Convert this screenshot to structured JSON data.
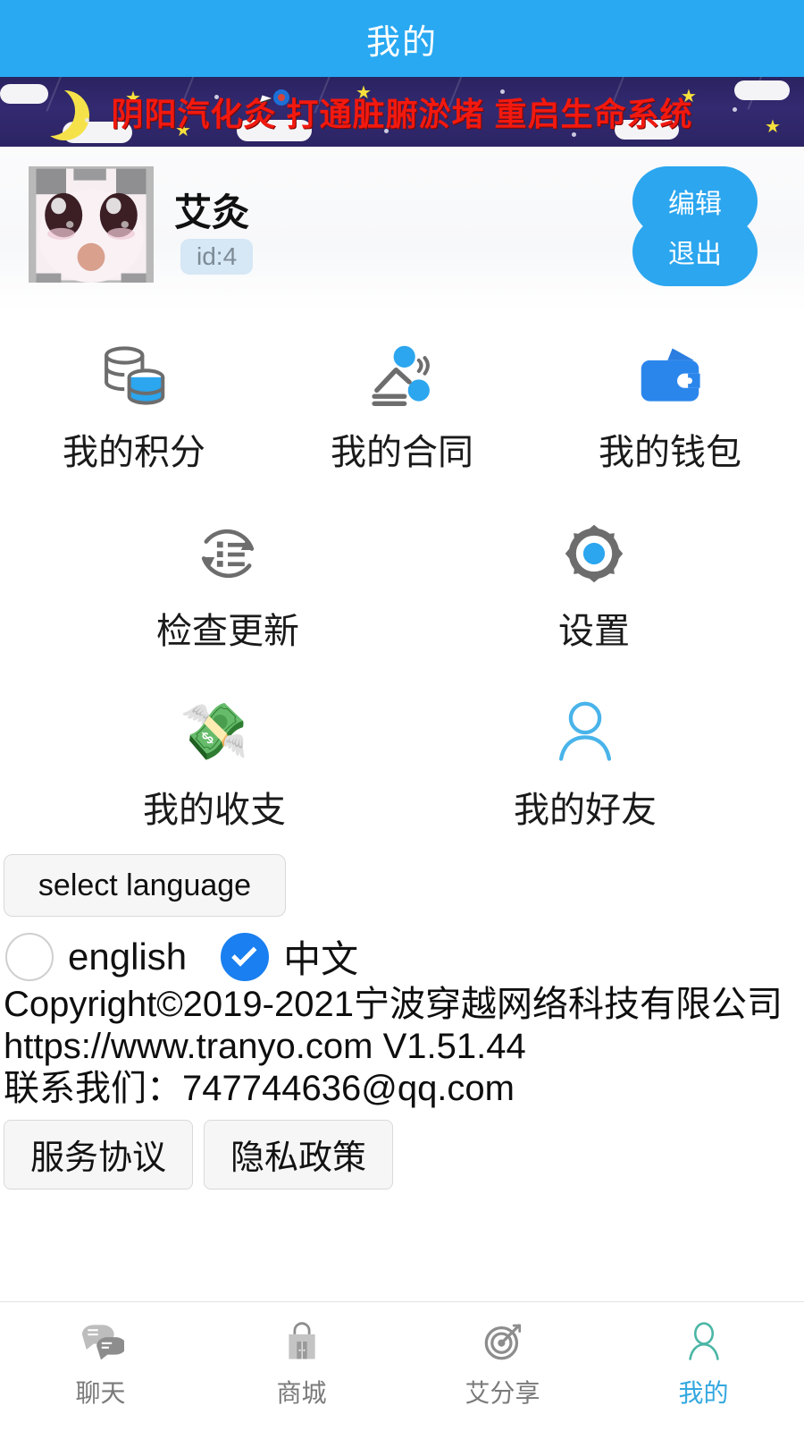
{
  "header": {
    "title": "我的",
    "bg_color": "#29a9f2",
    "text_color": "#ffffff"
  },
  "banner": {
    "text": "阴阳汽化灸 打通脏腑淤堵 重启生命系统",
    "text_color": "#f2190f",
    "bg_color": "#2e2768"
  },
  "profile": {
    "name": "艾灸",
    "id_badge": "id:4",
    "avatar_alt": "anime-bunny-avatar",
    "edit_label": "编辑",
    "logout_label": "退出",
    "button_color": "#2ba6ef"
  },
  "menu": {
    "row1": [
      {
        "label": "我的积分",
        "icon": "database-icon"
      },
      {
        "label": "我的合同",
        "icon": "massage-contract-icon"
      },
      {
        "label": "我的钱包",
        "icon": "wallet-icon"
      }
    ],
    "row2": [
      {
        "label": "检查更新",
        "icon": "refresh-list-icon"
      },
      {
        "label": "设置",
        "icon": "gear-icon"
      }
    ],
    "row3": [
      {
        "label": "我的收支",
        "icon": "money-hand-icon",
        "glyph": "💸"
      },
      {
        "label": "我的好友",
        "icon": "person-icon"
      }
    ]
  },
  "language": {
    "select_label": "select language",
    "options": [
      {
        "label": "english",
        "checked": false
      },
      {
        "label": "中文",
        "checked": true
      }
    ],
    "checked_color": "#1a7ff0"
  },
  "footer": {
    "lines": [
      "Copyright©2019-2021宁波穿越网络科技有限公司",
      "https://www.tranyo.com V1.51.44",
      "联系我们：747744636@qq.com"
    ],
    "buttons": [
      {
        "label": "服务协议"
      },
      {
        "label": "隐私政策"
      }
    ]
  },
  "tabbar": {
    "active_color": "#35a8e0",
    "inactive_color": "#7a7a7a",
    "tabs": [
      {
        "label": "聊天",
        "icon": "chat-bubbles-icon",
        "active": false
      },
      {
        "label": "商城",
        "icon": "shopping-bag-icon",
        "active": false
      },
      {
        "label": "艾分享",
        "icon": "target-icon",
        "active": false
      },
      {
        "label": "我的",
        "icon": "person-icon",
        "active": true
      }
    ]
  }
}
